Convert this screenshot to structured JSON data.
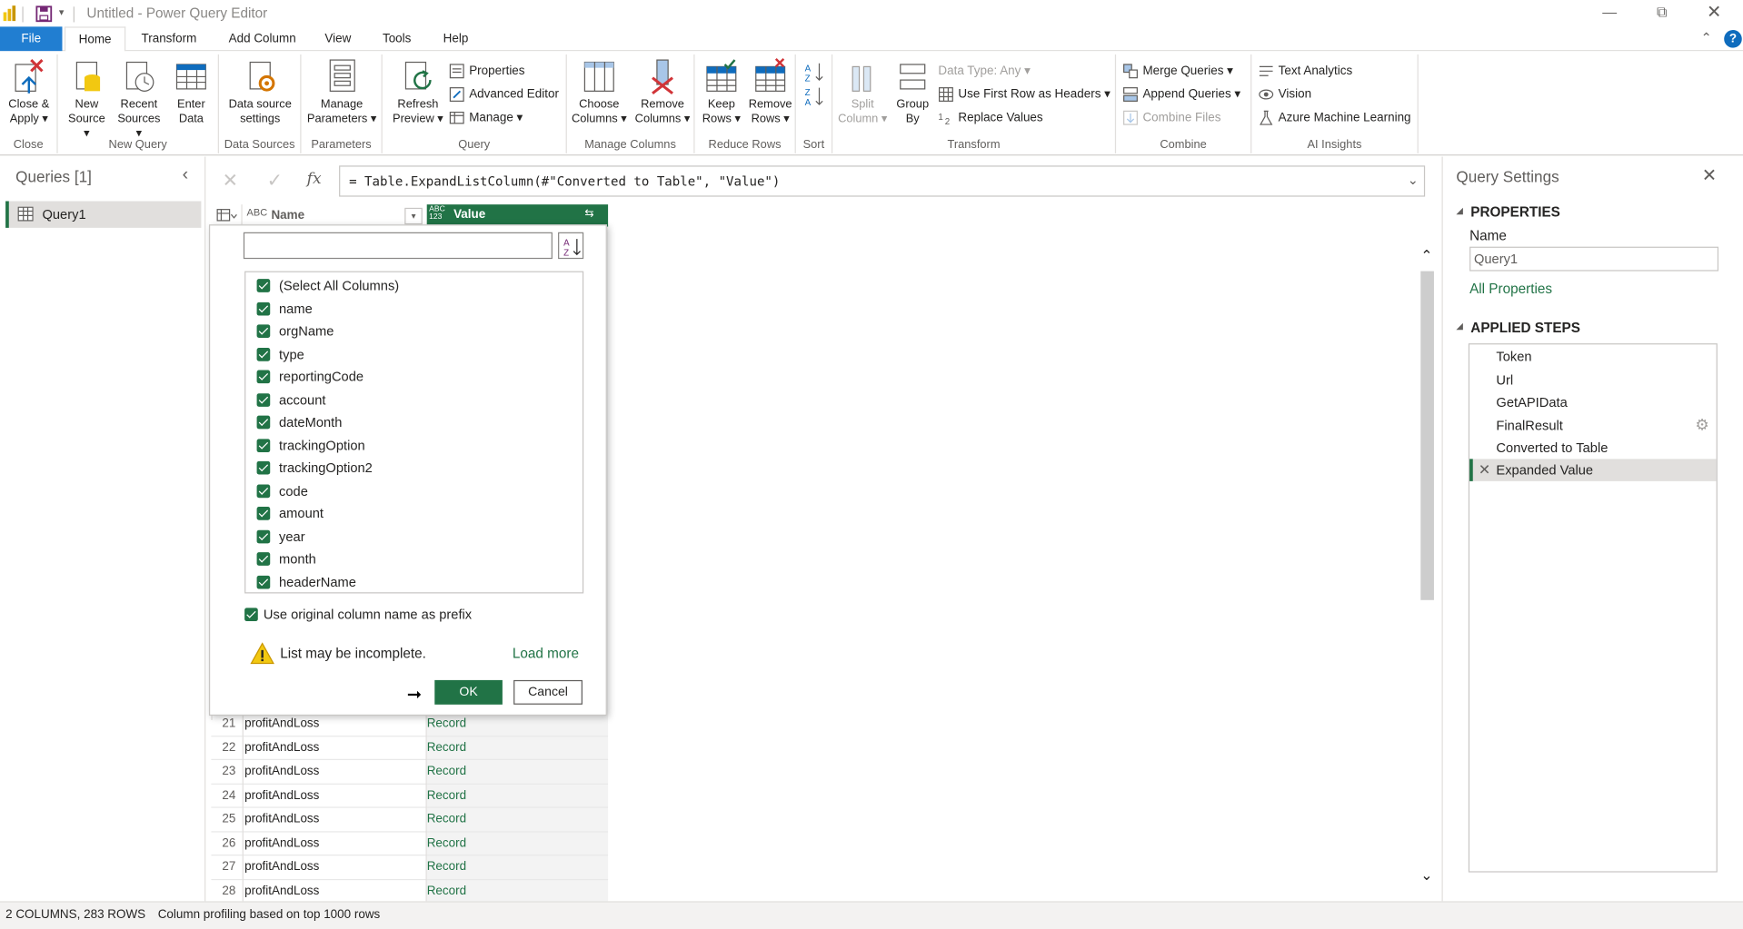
{
  "window": {
    "title": "Untitled - Power Query Editor",
    "help": "?"
  },
  "menu": {
    "tabs": [
      "File",
      "Home",
      "Transform",
      "Add Column",
      "View",
      "Tools",
      "Help"
    ]
  },
  "ribbon": {
    "groups": {
      "close": "Close",
      "new_query": "New Query",
      "data_sources": "Data Sources",
      "parameters": "Parameters",
      "query": "Query",
      "manage_columns": "Manage Columns",
      "reduce_rows": "Reduce Rows",
      "sort": "Sort",
      "transform": "Transform",
      "combine": "Combine",
      "ai_insights": "AI Insights"
    },
    "close_apply": [
      "Close &",
      "Apply ▾"
    ],
    "new_source": [
      "New",
      "Source ▾"
    ],
    "recent_sources": [
      "Recent",
      "Sources ▾"
    ],
    "enter_data": [
      "Enter",
      "Data"
    ],
    "data_source_settings": [
      "Data source",
      "settings"
    ],
    "manage_parameters": [
      "Manage",
      "Parameters ▾"
    ],
    "refresh_preview": [
      "Refresh",
      "Preview ▾"
    ],
    "properties": "Properties",
    "advanced_editor": "Advanced Editor",
    "manage": "Manage ▾",
    "choose_columns": [
      "Choose",
      "Columns ▾"
    ],
    "remove_columns": [
      "Remove",
      "Columns ▾"
    ],
    "keep_rows": [
      "Keep",
      "Rows ▾"
    ],
    "remove_rows": [
      "Remove",
      "Rows ▾"
    ],
    "split_column": [
      "Split",
      "Column ▾"
    ],
    "group_by": [
      "Group",
      "By"
    ],
    "data_type": "Data Type: Any ▾",
    "first_row_headers": "Use First Row as Headers ▾",
    "replace_values": "Replace Values",
    "merge_queries": "Merge Queries ▾",
    "append_queries": "Append Queries ▾",
    "combine_files": "Combine Files",
    "text_analytics": "Text Analytics",
    "vision": "Vision",
    "azure_ml": "Azure Machine Learning"
  },
  "queries": {
    "header": "Queries [1]",
    "items": [
      "Query1"
    ]
  },
  "formula": {
    "text": "= Table.ExpandListColumn(#\"Converted to Table\", \"Value\")",
    "fx": "fx"
  },
  "grid": {
    "columns": [
      {
        "type": "ABC",
        "name": "Name"
      },
      {
        "type": "ABC 123",
        "name": "Value"
      }
    ],
    "rows": [
      {
        "n": "21",
        "name": "profitAndLoss",
        "value": "Record"
      },
      {
        "n": "22",
        "name": "profitAndLoss",
        "value": "Record"
      },
      {
        "n": "23",
        "name": "profitAndLoss",
        "value": "Record"
      },
      {
        "n": "24",
        "name": "profitAndLoss",
        "value": "Record"
      },
      {
        "n": "25",
        "name": "profitAndLoss",
        "value": "Record"
      },
      {
        "n": "26",
        "name": "profitAndLoss",
        "value": "Record"
      },
      {
        "n": "27",
        "name": "profitAndLoss",
        "value": "Record"
      },
      {
        "n": "28",
        "name": "profitAndLoss",
        "value": "Record"
      }
    ]
  },
  "expand_dialog": {
    "search_value": "",
    "columns": [
      "(Select All Columns)",
      "name",
      "orgName",
      "type",
      "reportingCode",
      "account",
      "dateMonth",
      "trackingOption",
      "trackingOption2",
      "code",
      "amount",
      "year",
      "month",
      "headerName"
    ],
    "prefix_label": "Use original column name as prefix",
    "warning": "List may be incomplete.",
    "load_more": "Load more",
    "ok": "OK",
    "cancel": "Cancel"
  },
  "settings": {
    "title": "Query Settings",
    "properties_header": "PROPERTIES",
    "name_label": "Name",
    "name_value": "Query1",
    "all_properties": "All Properties",
    "steps_header": "APPLIED STEPS",
    "steps": [
      "Token",
      "Url",
      "GetAPIData",
      "FinalResult",
      "Converted to Table",
      "Expanded Value"
    ]
  },
  "status": {
    "rows": "2 COLUMNS, 283 ROWS",
    "profiling": "Column profiling based on top 1000 rows"
  },
  "colors": {
    "accent": "#217346",
    "file_tab": "#217ed1"
  }
}
